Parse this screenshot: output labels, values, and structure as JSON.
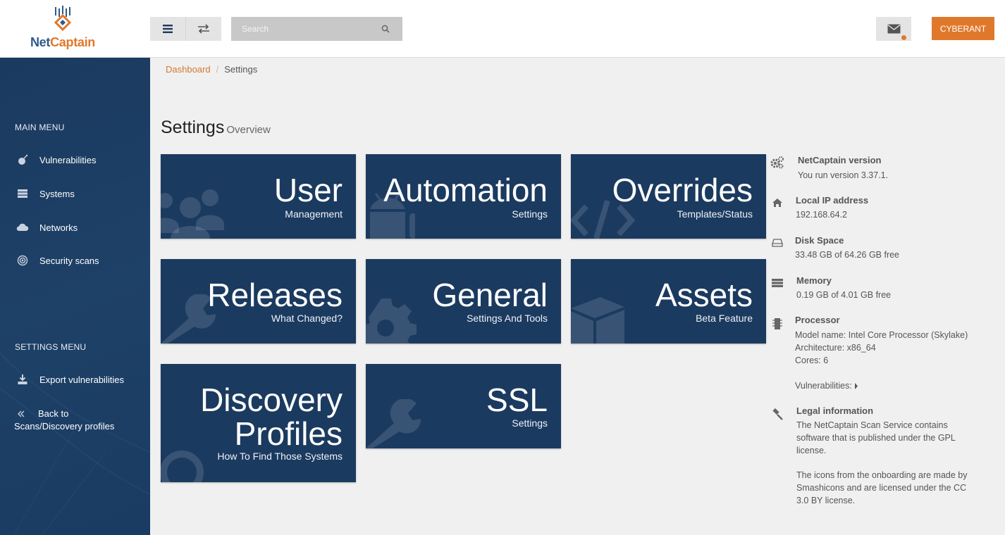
{
  "header": {
    "logo_text_net": "Net",
    "logo_text_captain": "Captain",
    "search_placeholder": "Search",
    "user_button": "CYBERANT"
  },
  "sidebar": {
    "main_menu_title": "MAIN MENU",
    "main_items": [
      {
        "label": "Vulnerabilities",
        "icon": "bomb-icon"
      },
      {
        "label": "Systems",
        "icon": "server-icon"
      },
      {
        "label": "Networks",
        "icon": "cloud-icon"
      },
      {
        "label": "Security scans",
        "icon": "target-icon"
      }
    ],
    "settings_menu_title": "SETTINGS MENU",
    "settings_items": [
      {
        "label": "Export vulnerabilities",
        "icon": "download-icon"
      },
      {
        "label": "Back to Scans/Discovery profiles",
        "icon": "double-chevron-left-icon"
      }
    ]
  },
  "breadcrumb": {
    "link": "Dashboard",
    "separator": "/",
    "current": "Settings"
  },
  "page": {
    "title": "Settings",
    "subtitle": "Overview"
  },
  "tiles": [
    {
      "title": "User",
      "subtitle": "Management",
      "icon": "users-icon"
    },
    {
      "title": "Automation",
      "subtitle": "Settings",
      "icon": "android-icon"
    },
    {
      "title": "Overrides",
      "subtitle": "Templates/Status",
      "icon": "code-icon"
    },
    {
      "title": "Releases",
      "subtitle": "What Changed?",
      "icon": "wrench-icon"
    },
    {
      "title": "General",
      "subtitle": "Settings And Tools",
      "icon": "gear-icon"
    },
    {
      "title": "Assets",
      "subtitle": "Beta Feature",
      "icon": "cube-icon"
    },
    {
      "title_line1": "Discovery",
      "title_line2": "Profiles",
      "subtitle": "How To Find Those Systems",
      "icon": "magnifier-icon"
    },
    {
      "title": "SSL",
      "subtitle": "Settings",
      "icon": "wrench-icon"
    }
  ],
  "info": {
    "version_head": "NetCaptain version",
    "version_text": "You run version 3.37.1.",
    "ip_head": "Local IP address",
    "ip_text": "192.168.64.2",
    "disk_head": "Disk Space",
    "disk_text": "33.48 GB of 64.26 GB free",
    "memory_head": "Memory",
    "memory_text": "0.19 GB of 4.01 GB free",
    "processor_head": "Processor",
    "processor_model": "Model name: Intel Core Processor (Skylake)",
    "processor_arch": "Architecture: x86_64",
    "processor_cores": "Cores: 6",
    "vulnerabilities_toggle": "Vulnerabilities:",
    "legal_head": "Legal information",
    "legal_text1": "The NetCaptain Scan Service contains software that is published under the GPL license.",
    "legal_text2": "The icons from the onboarding are made by Smashicons and are licensed under the CC 3.0 BY license."
  },
  "colors": {
    "brand_orange": "#e0782b",
    "navy": "#1b3a5f",
    "background": "#f0f0f0"
  }
}
